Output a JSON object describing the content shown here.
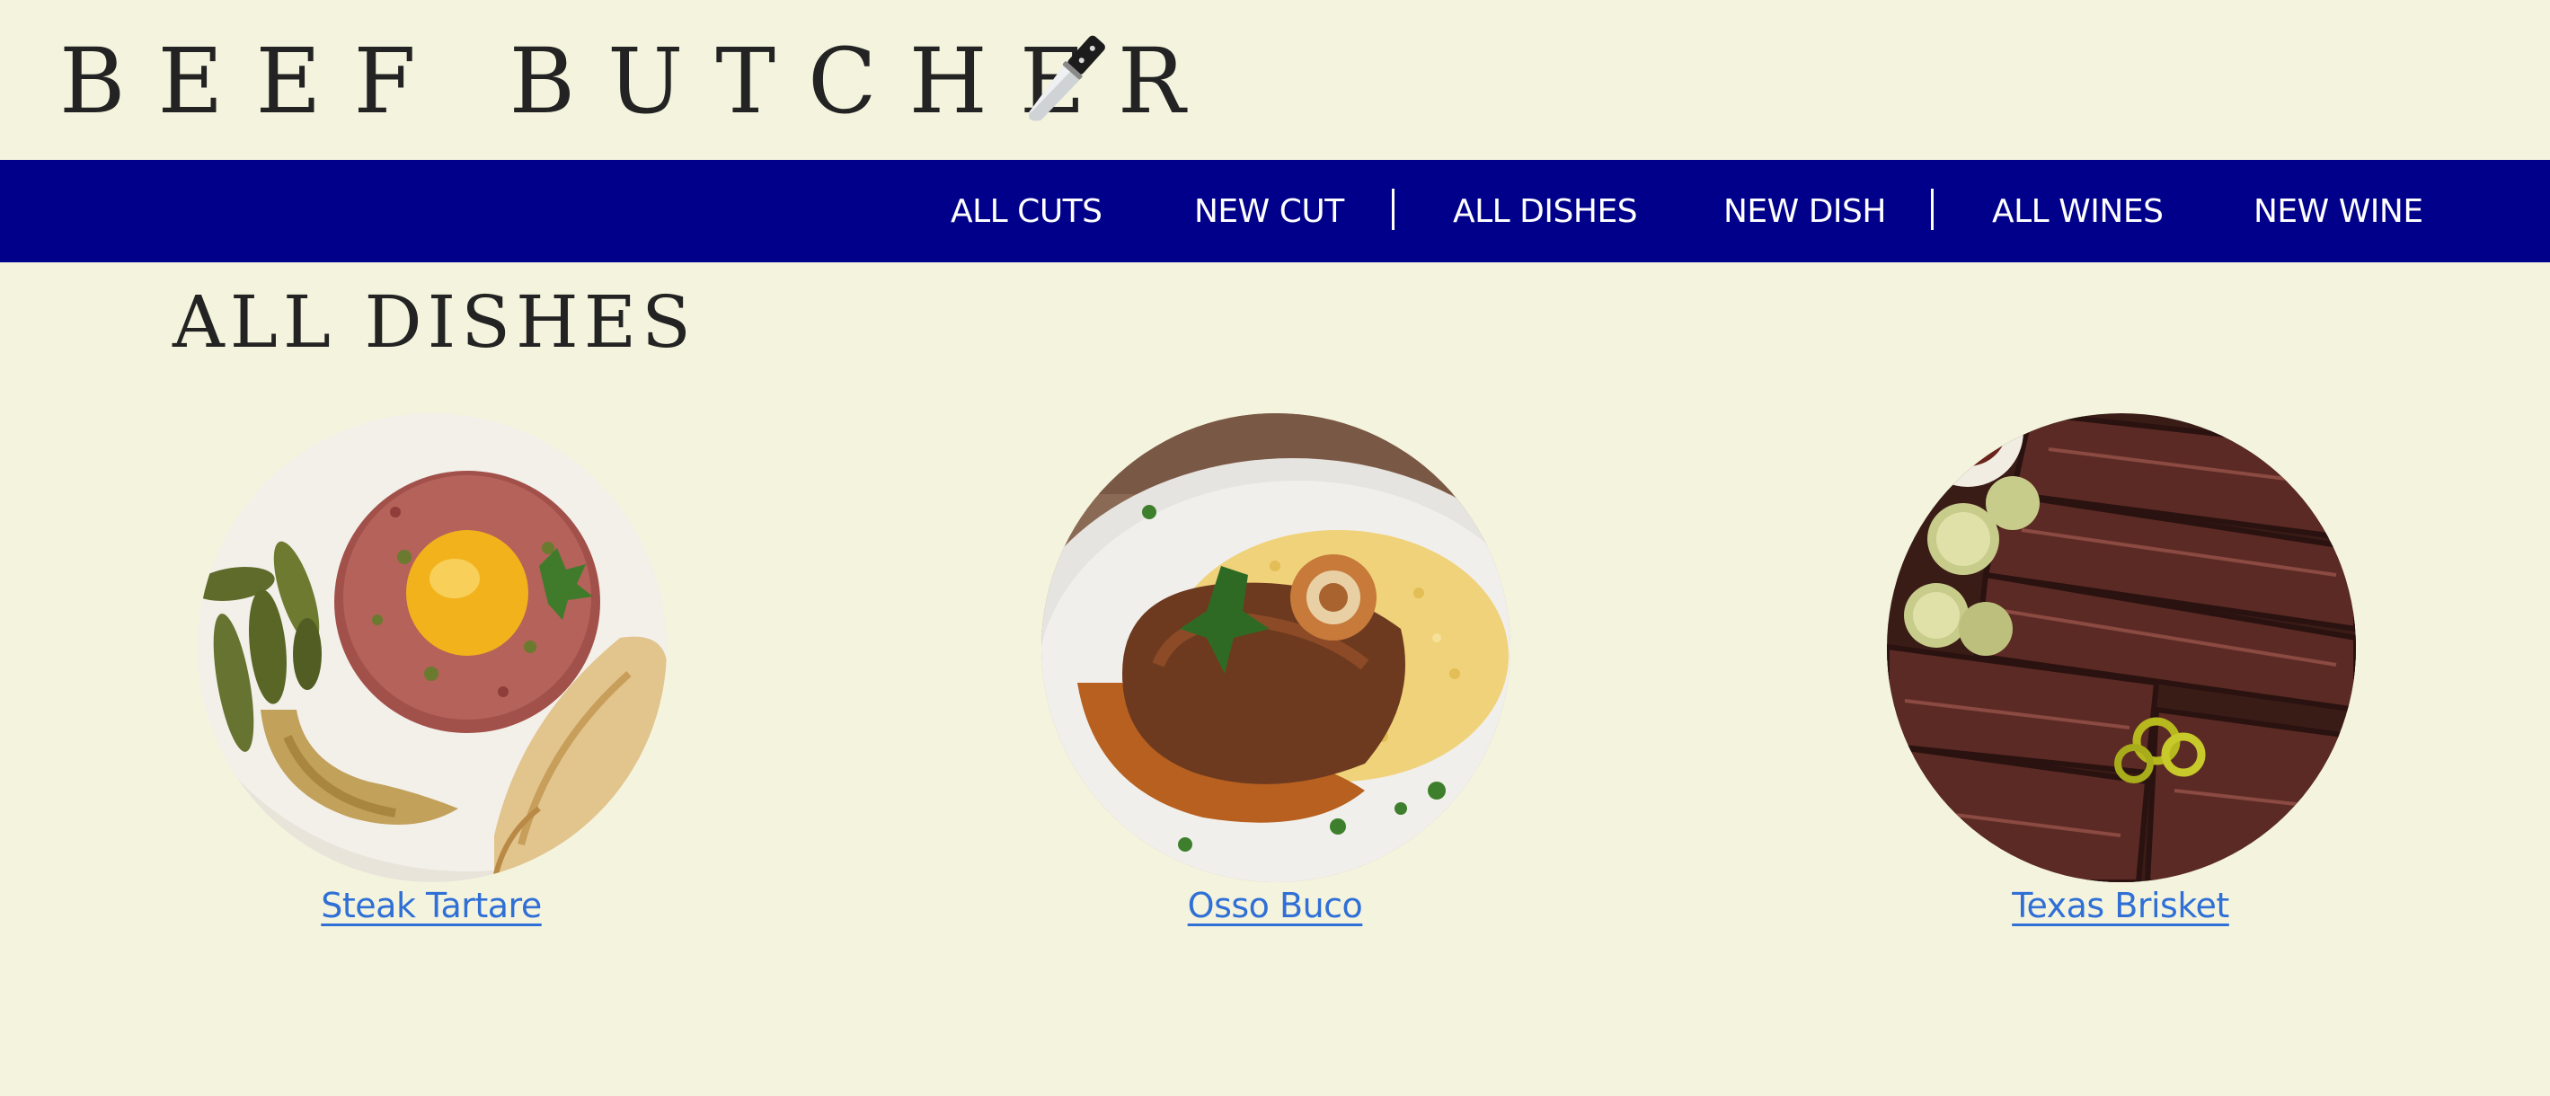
{
  "brand": {
    "name": "BEEF BUTCHER",
    "icon": "kitchen-knife-icon"
  },
  "nav": {
    "items": [
      {
        "label": "ALL CUTS"
      },
      {
        "label": "NEW CUT"
      },
      {
        "label": "ALL DISHES"
      },
      {
        "label": "NEW DISH"
      },
      {
        "label": "ALL WINES"
      },
      {
        "label": "NEW WINE"
      }
    ],
    "background": "#00008b",
    "text_color": "#ffffff"
  },
  "main": {
    "title": "ALL DISHES",
    "dishes": [
      {
        "name": "Steak Tartare"
      },
      {
        "name": "Osso Buco"
      },
      {
        "name": "Texas Brisket"
      }
    ]
  },
  "colors": {
    "page_background": "#f4f4de",
    "link": "#2f6fd6"
  }
}
